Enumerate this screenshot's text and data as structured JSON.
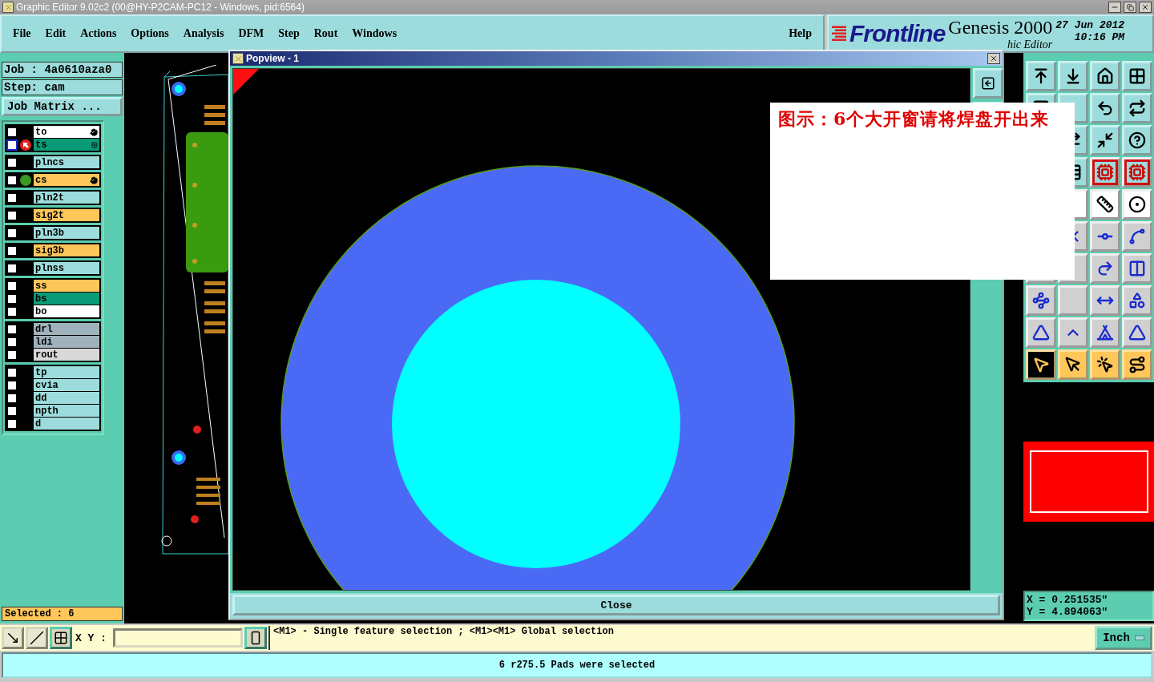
{
  "window": {
    "title": "Graphic Editor 9.02c2 (00@HY-P2CAM-PC12 - Windows, pid:6564)"
  },
  "menu": [
    {
      "label": "File"
    },
    {
      "label": "Edit"
    },
    {
      "label": "Actions"
    },
    {
      "label": "Options"
    },
    {
      "label": "Analysis"
    },
    {
      "label": "DFM"
    },
    {
      "label": "Step"
    },
    {
      "label": "Rout"
    },
    {
      "label": "Windows"
    }
  ],
  "help_menu": "Help",
  "logo": {
    "brand": "Frontline",
    "product": "Genesis 2000",
    "date": "27 Jun 2012",
    "time": "10:16 PM",
    "subtitle": "hic Editor"
  },
  "job": {
    "job": "Job : 4a0610aza0",
    "step": "Step: cam",
    "matrix_button": "Job Matrix ..."
  },
  "layer_groups": [
    {
      "layers": [
        {
          "name": "to",
          "color": "#ffffff",
          "checked": false,
          "work": false,
          "shown": false,
          "affected": true
        },
        {
          "name": "ts",
          "color": "#0a9a78",
          "checked": false,
          "work": true,
          "shown": false,
          "affected": false
        }
      ]
    },
    {
      "layers": [
        {
          "name": "plncs",
          "color": "#9ddcdc",
          "checked": false,
          "work": false,
          "shown": false,
          "affected": false
        }
      ]
    },
    {
      "layers": [
        {
          "name": "cs",
          "color": "#ffc65a",
          "checked": false,
          "work": false,
          "shown": true,
          "affected": true
        }
      ]
    },
    {
      "layers": [
        {
          "name": "pln2t",
          "color": "#9ddcdc",
          "checked": false,
          "work": false,
          "shown": false,
          "affected": false
        }
      ]
    },
    {
      "layers": [
        {
          "name": "sig2t",
          "color": "#ffc65a",
          "checked": false,
          "work": false,
          "shown": false,
          "affected": false
        }
      ]
    },
    {
      "layers": [
        {
          "name": "pln3b",
          "color": "#9ddcdc",
          "checked": false,
          "work": false,
          "shown": false,
          "affected": false
        }
      ]
    },
    {
      "layers": [
        {
          "name": "sig3b",
          "color": "#ffc65a",
          "checked": false,
          "work": false,
          "shown": false,
          "affected": false
        }
      ]
    },
    {
      "layers": [
        {
          "name": "plnss",
          "color": "#9ddcdc",
          "checked": false,
          "work": false,
          "shown": false,
          "affected": false
        }
      ]
    },
    {
      "layers": [
        {
          "name": "ss",
          "color": "#ffc65a",
          "checked": false,
          "work": false,
          "shown": false,
          "affected": false
        },
        {
          "name": "bs",
          "color": "#0a9a78",
          "checked": false,
          "work": false,
          "shown": false,
          "affected": false
        },
        {
          "name": "bo",
          "color": "#ffffff",
          "checked": false,
          "work": false,
          "shown": false,
          "affected": false
        }
      ]
    },
    {
      "layers": [
        {
          "name": "drl",
          "color": "#9fb2bc",
          "checked": false,
          "work": false,
          "shown": false,
          "affected": false
        },
        {
          "name": "ldi",
          "color": "#9fb2bc",
          "checked": false,
          "work": false,
          "shown": false,
          "affected": false
        },
        {
          "name": "rout",
          "color": "#d8d8d8",
          "checked": false,
          "work": false,
          "shown": false,
          "affected": false
        }
      ]
    },
    {
      "layers": [
        {
          "name": "tp",
          "color": "#9ddcdc",
          "checked": false,
          "work": false,
          "shown": false,
          "affected": false
        },
        {
          "name": "cvia",
          "color": "#9ddcdc",
          "checked": false,
          "work": false,
          "shown": false,
          "affected": false
        },
        {
          "name": "dd",
          "color": "#9ddcdc",
          "checked": false,
          "work": false,
          "shown": false,
          "affected": false
        },
        {
          "name": "npth",
          "color": "#9ddcdc",
          "checked": false,
          "work": false,
          "shown": false,
          "affected": false
        },
        {
          "name": "d",
          "color": "#9ddcdc",
          "checked": false,
          "work": false,
          "shown": false,
          "affected": false
        }
      ]
    }
  ],
  "selected_count": "Selected : 6",
  "popview": {
    "title": "Popview - 1",
    "close_button": "Close"
  },
  "annotation": "图示：6个大开窗请将焊盘开出来",
  "coordinates": {
    "x": "X = 0.251535\"",
    "y": "Y = 4.894063\""
  },
  "command_bar": {
    "xy_label": "X Y :",
    "message": "<M1> - Single feature selection ; <M1><M1> Global selection",
    "units": "Inch"
  },
  "status": "6 r275.5 Pads were selected"
}
